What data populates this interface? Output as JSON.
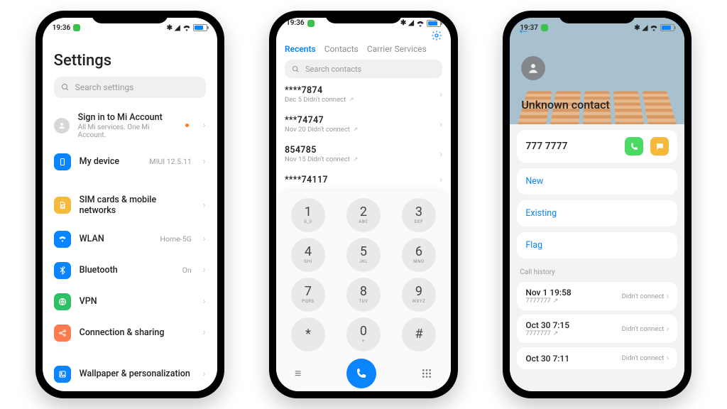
{
  "status": {
    "time1": "19:36",
    "time2": "19:36",
    "time3": "19:37"
  },
  "settings": {
    "title": "Settings",
    "search_placeholder": "Search settings",
    "account": {
      "title": "Sign in to Mi Account",
      "subtitle": "All Mi services. One Mi Account."
    },
    "mydevice": {
      "label": "My device",
      "value": "MIUI 12.5.11"
    },
    "items": [
      {
        "label": "SIM cards & mobile networks",
        "value": "",
        "icon": "sim-icon",
        "color": "#f5b93e"
      },
      {
        "label": "WLAN",
        "value": "Home-5G",
        "icon": "wifi-icon",
        "color": "#0a84ff"
      },
      {
        "label": "Bluetooth",
        "value": "On",
        "icon": "bluetooth-icon",
        "color": "#0a84ff"
      },
      {
        "label": "VPN",
        "value": "",
        "icon": "vpn-icon",
        "color": "#2fbf66"
      },
      {
        "label": "Connection & sharing",
        "value": "",
        "icon": "share-icon",
        "color": "#ff7a4d"
      }
    ],
    "wallpaper": {
      "label": "Wallpaper & personalization",
      "icon": "wallpaper-icon",
      "color": "#0a84ff"
    }
  },
  "dialer": {
    "tabs": [
      "Recents",
      "Contacts",
      "Carrier Services"
    ],
    "active_tab": "Recents",
    "search_placeholder": "Search contacts",
    "recents": [
      {
        "number": "****7874",
        "sub": "Dec 5 Didn't connect"
      },
      {
        "number": "***74747",
        "sub": "Nov 20 Didn't connect"
      },
      {
        "number": "854785",
        "sub": "Nov 15 Didn't connect"
      },
      {
        "number": "****74117",
        "sub": ""
      }
    ],
    "keys": [
      {
        "d": "1",
        "l": "0_0"
      },
      {
        "d": "2",
        "l": "ABC"
      },
      {
        "d": "3",
        "l": "DEF"
      },
      {
        "d": "4",
        "l": "GHI"
      },
      {
        "d": "5",
        "l": "JKL"
      },
      {
        "d": "6",
        "l": "MNO"
      },
      {
        "d": "7",
        "l": "PQRS"
      },
      {
        "d": "8",
        "l": "TUV"
      },
      {
        "d": "9",
        "l": "WXYZ"
      },
      {
        "d": "*",
        "l": ""
      },
      {
        "d": "0",
        "l": "+"
      },
      {
        "d": "#",
        "l": ""
      }
    ]
  },
  "contact": {
    "name": "Unknown contact",
    "number": "777 7777",
    "actions": [
      "New",
      "Existing",
      "Flag"
    ],
    "history_title": "Call history",
    "history": [
      {
        "time": "Nov 1 19:58",
        "sub": "7777777",
        "status": "Didn't connect"
      },
      {
        "time": "Oct 30 7:15",
        "sub": "7777777",
        "status": "Didn't connect"
      },
      {
        "time": "Oct 30 7:11",
        "sub": "",
        "status": "Didn't connect"
      }
    ]
  }
}
